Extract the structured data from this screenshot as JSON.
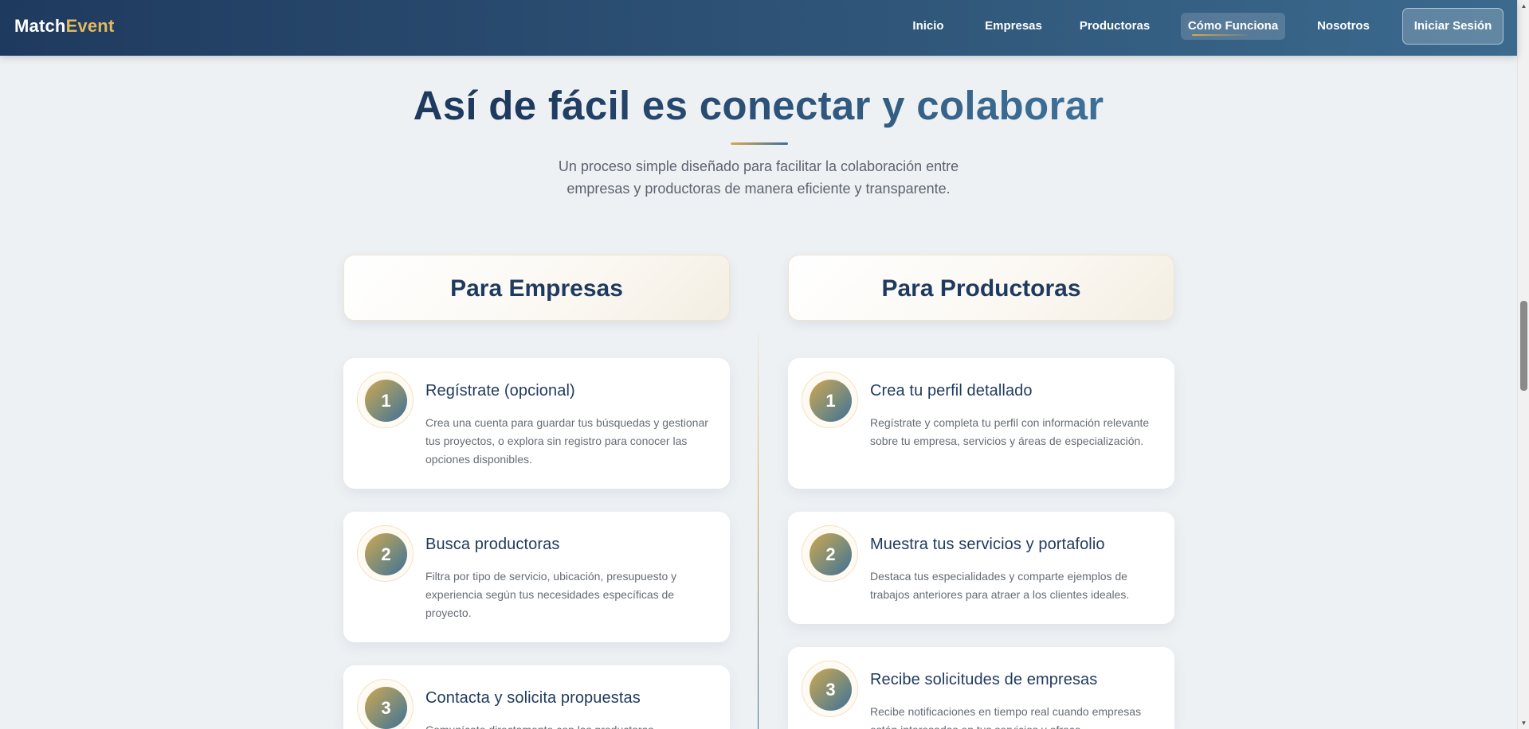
{
  "nav": {
    "brand_part1": "Match",
    "brand_part2": "Event",
    "items": [
      {
        "label": "Inicio"
      },
      {
        "label": "Empresas"
      },
      {
        "label": "Productoras"
      },
      {
        "label": "Cómo Funciona"
      },
      {
        "label": "Nosotros"
      }
    ],
    "active_item": "Cómo Funciona",
    "login_label": "Iniciar Sesión"
  },
  "hero": {
    "title": "Así de fácil es conectar y colaborar",
    "subtitle_line1": "Un proceso simple diseñado para facilitar la colaboración entre",
    "subtitle_line2": "empresas y productoras de manera eficiente y transparente."
  },
  "empresas": {
    "heading": "Para Empresas",
    "steps": [
      {
        "number": "1",
        "title": "Regístrate (opcional)",
        "desc": "Crea una cuenta para guardar tus búsquedas y gestionar tus proyectos, o explora sin registro para conocer las opciones disponibles."
      },
      {
        "number": "2",
        "title": "Busca productoras",
        "desc": "Filtra por tipo de servicio, ubicación, presupuesto y experiencia según tus necesidades específicas de proyecto."
      },
      {
        "number": "3",
        "title": "Contacta y solicita propuestas",
        "desc": "Comunícate directamente con las productoras..."
      }
    ]
  },
  "productoras": {
    "heading": "Para Productoras",
    "steps": [
      {
        "number": "1",
        "title": "Crea tu perfil detallado",
        "desc": "Regístrate y completa tu perfil con información relevante sobre tu empresa, servicios y áreas de especialización."
      },
      {
        "number": "2",
        "title": "Muestra tus servicios y portafolio",
        "desc": "Destaca tus especialidades y comparte ejemplos de trabajos anteriores para atraer a los clientes ideales."
      },
      {
        "number": "3",
        "title": "Recibe solicitudes de empresas",
        "desc": "Recibe notificaciones en tiempo real cuando empresas estén interesadas en tus servicios y ofrece..."
      }
    ]
  },
  "colors": {
    "navy": "#1f3a5f",
    "steel_blue": "#3d6f96",
    "gold": "#d9a94a",
    "background": "#eef1f4"
  },
  "icons": {
    "scroll_up": "triangle-up",
    "scroll_down": "triangle-down"
  }
}
